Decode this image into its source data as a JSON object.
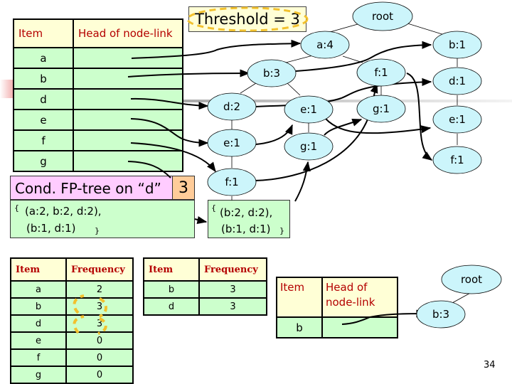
{
  "header_table": {
    "col_item": "Item",
    "col_head": "Head of node-link",
    "items": [
      "a",
      "b",
      "d",
      "e",
      "f",
      "g"
    ]
  },
  "threshold": {
    "label": "Threshold = 3"
  },
  "fp_tree": {
    "nodes": {
      "root": "root",
      "a4": "a:4",
      "b3": "b:3",
      "d2": "d:2",
      "e1_left": "e:1",
      "f1_left": "f:1",
      "e1_mid": "e:1",
      "g1_mid": "g:1",
      "f1_mid": "f:1",
      "g1_right": "g:1",
      "b1": "b:1",
      "d1": "d:1",
      "e1_right": "e:1",
      "f1_right": "f:1"
    }
  },
  "conditional": {
    "title": "Cond. FP-tree on “d”",
    "count": "3",
    "open_brace": "{",
    "close_brace": "}",
    "patterns_line1": "(a:2, b:2, d:2),",
    "patterns_line2": "(b:1, d:1)",
    "filtered_line1": "(b:2, d:2),",
    "filtered_line2": "(b:1, d:1)"
  },
  "freq_table": {
    "col_item": "Item",
    "col_freq": "Frequency",
    "rows": [
      {
        "item": "a",
        "freq": "2"
      },
      {
        "item": "b",
        "freq": "3"
      },
      {
        "item": "d",
        "freq": "3"
      },
      {
        "item": "e",
        "freq": "0"
      },
      {
        "item": "f",
        "freq": "0"
      },
      {
        "item": "g",
        "freq": "0"
      }
    ]
  },
  "frequent_table": {
    "col_item": "Item",
    "col_freq": "Frequency",
    "rows": [
      {
        "item": "b",
        "freq": "3"
      },
      {
        "item": "d",
        "freq": "3"
      }
    ]
  },
  "result_table": {
    "col_item": "Item",
    "col_head_line1": "Head of",
    "col_head_line2": "node-link",
    "items": [
      "b"
    ]
  },
  "result_tree": {
    "root": "root",
    "b3": "b:3"
  },
  "colors": {
    "header_bg": "#ffffd6",
    "header_text": "#b40000",
    "cell_bg": "#ccffcc",
    "node_fill": "#ccf5fb",
    "cond_title_bg": "#ffccff",
    "cond_count_bg": "#ffcc99",
    "highlight_dash": "#f2c12e"
  },
  "page_number": "34"
}
